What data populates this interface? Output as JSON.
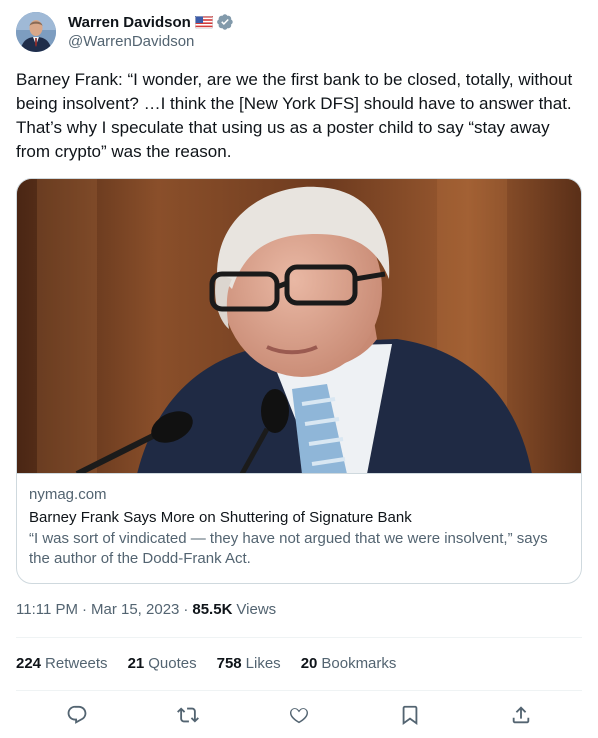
{
  "author": {
    "display_name": "Warren Davidson",
    "handle": "@WarrenDavidson",
    "flag_icon": "us-flag-icon",
    "verified_icon": "verified-badge-icon",
    "verified_color": "#829aab"
  },
  "tweet": {
    "text": "Barney Frank: “I wonder, are we the first bank to be closed, totally, without being insolvent? …I think the [New York DFS] should have to answer that. That’s why I speculate that using us as a poster child to say “stay away from crypto” was the reason."
  },
  "card": {
    "domain": "nymag.com",
    "title": "Barney Frank Says More on Shuttering of Signature Bank",
    "description": "“I was sort of vindicated — they have not argued that we were insolvent,” says the author of the Dodd-Frank Act."
  },
  "meta": {
    "time": "11:11 PM",
    "separator": "·",
    "date": "Mar 15, 2023",
    "views_count": "85.5K",
    "views_label": "Views"
  },
  "stats": [
    {
      "count": "224",
      "label": "Retweets"
    },
    {
      "count": "21",
      "label": "Quotes"
    },
    {
      "count": "758",
      "label": "Likes"
    },
    {
      "count": "20",
      "label": "Bookmarks"
    }
  ],
  "actions": [
    {
      "name": "reply-icon"
    },
    {
      "name": "retweet-icon"
    },
    {
      "name": "like-icon"
    },
    {
      "name": "bookmark-icon"
    },
    {
      "name": "share-icon"
    }
  ],
  "colors": {
    "text_primary": "#0f1419",
    "text_secondary": "#536471",
    "border": "#cfd9de",
    "divider": "#eff3f4"
  }
}
